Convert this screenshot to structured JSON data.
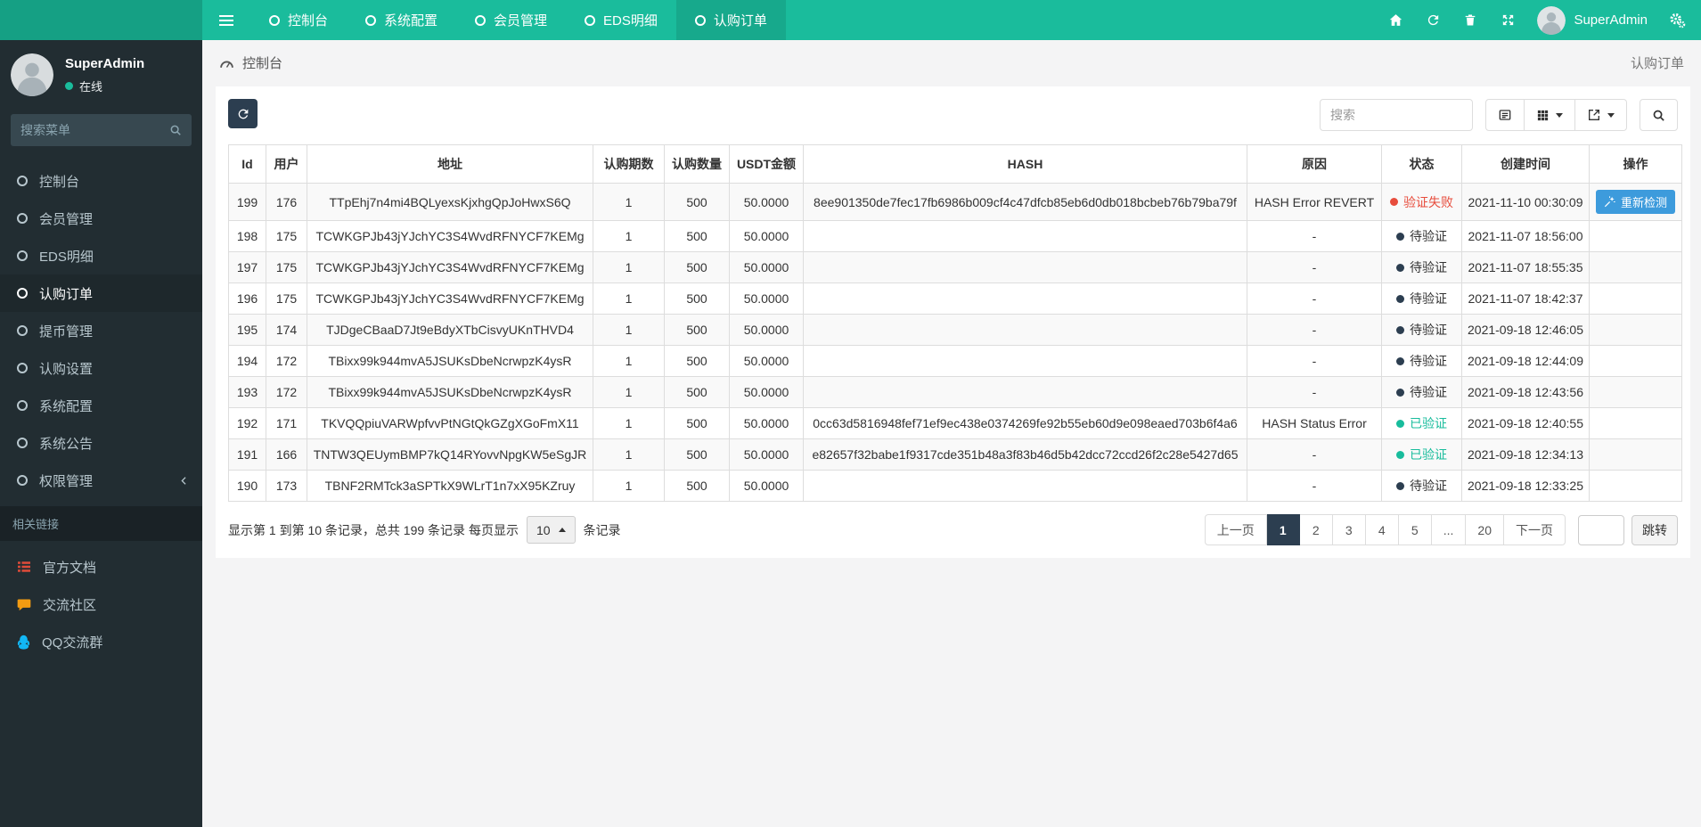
{
  "colors": {
    "navbar": "#1abc9c",
    "sidebar": "#222d32",
    "status_fail": "#e74c3c",
    "status_pending": "#2c3e50",
    "status_ok": "#18bc9c",
    "recheck_button": "#3d9bdc",
    "pagination_active": "#2c3e50"
  },
  "navbar": {
    "menu": [
      {
        "label": "控制台",
        "active": false
      },
      {
        "label": "系统配置",
        "active": false
      },
      {
        "label": "会员管理",
        "active": false
      },
      {
        "label": "EDS明细",
        "active": false
      },
      {
        "label": "认购订单",
        "active": true
      }
    ],
    "user_name": "SuperAdmin"
  },
  "sidebar": {
    "user": {
      "name": "SuperAdmin",
      "status": "在线"
    },
    "search_placeholder": "搜索菜单",
    "items": [
      {
        "label": "控制台",
        "active": false
      },
      {
        "label": "会员管理",
        "active": false
      },
      {
        "label": "EDS明细",
        "active": false
      },
      {
        "label": "认购订单",
        "active": true
      },
      {
        "label": "提币管理",
        "active": false
      },
      {
        "label": "认购设置",
        "active": false
      },
      {
        "label": "系统配置",
        "active": false
      },
      {
        "label": "系统公告",
        "active": false
      },
      {
        "label": "权限管理",
        "active": false,
        "has_submenu": true
      }
    ],
    "section_label": "相关链接",
    "links": [
      {
        "label": "官方文档",
        "icon": "doc-list-icon",
        "color": "#dd4b39"
      },
      {
        "label": "交流社区",
        "icon": "comment-icon",
        "color": "#f39c12"
      },
      {
        "label": "QQ交流群",
        "icon": "qq-icon",
        "color": "#12b7f5"
      }
    ]
  },
  "breadcrumb": {
    "left": "控制台",
    "right": "认购订单"
  },
  "toolbar": {
    "search_placeholder": "搜索"
  },
  "table": {
    "columns": [
      "Id",
      "用户",
      "地址",
      "认购期数",
      "认购数量",
      "USDT金额",
      "HASH",
      "原因",
      "状态",
      "创建时间",
      "操作"
    ],
    "rows": [
      {
        "id": "199",
        "user": "176",
        "address": "TTpEhj7n4mi4BQLyexsKjxhgQpJoHwxS6Q",
        "period": "1",
        "quantity": "500",
        "usdt": "50.0000",
        "hash": "8ee901350de7fec17fb6986b009cf4c47dfcb85eb6d0db018bcbeb76b79ba79f",
        "reason": "HASH Error REVERT",
        "status": {
          "label": "验证失败",
          "type": "fail"
        },
        "created": "2021-11-10 00:30:09",
        "action": "重新检测"
      },
      {
        "id": "198",
        "user": "175",
        "address": "TCWKGPJb43jYJchYC3S4WvdRFNYCF7KEMg",
        "period": "1",
        "quantity": "500",
        "usdt": "50.0000",
        "hash": "",
        "reason": "-",
        "status": {
          "label": "待验证",
          "type": "pending"
        },
        "created": "2021-11-07 18:56:00",
        "action": null
      },
      {
        "id": "197",
        "user": "175",
        "address": "TCWKGPJb43jYJchYC3S4WvdRFNYCF7KEMg",
        "period": "1",
        "quantity": "500",
        "usdt": "50.0000",
        "hash": "",
        "reason": "-",
        "status": {
          "label": "待验证",
          "type": "pending"
        },
        "created": "2021-11-07 18:55:35",
        "action": null
      },
      {
        "id": "196",
        "user": "175",
        "address": "TCWKGPJb43jYJchYC3S4WvdRFNYCF7KEMg",
        "period": "1",
        "quantity": "500",
        "usdt": "50.0000",
        "hash": "",
        "reason": "-",
        "status": {
          "label": "待验证",
          "type": "pending"
        },
        "created": "2021-11-07 18:42:37",
        "action": null
      },
      {
        "id": "195",
        "user": "174",
        "address": "TJDgeCBaaD7Jt9eBdyXTbCisvyUKnTHVD4",
        "period": "1",
        "quantity": "500",
        "usdt": "50.0000",
        "hash": "",
        "reason": "-",
        "status": {
          "label": "待验证",
          "type": "pending"
        },
        "created": "2021-09-18 12:46:05",
        "action": null
      },
      {
        "id": "194",
        "user": "172",
        "address": "TBixx99k944mvA5JSUKsDbeNcrwpzK4ysR",
        "period": "1",
        "quantity": "500",
        "usdt": "50.0000",
        "hash": "",
        "reason": "-",
        "status": {
          "label": "待验证",
          "type": "pending"
        },
        "created": "2021-09-18 12:44:09",
        "action": null
      },
      {
        "id": "193",
        "user": "172",
        "address": "TBixx99k944mvA5JSUKsDbeNcrwpzK4ysR",
        "period": "1",
        "quantity": "500",
        "usdt": "50.0000",
        "hash": "",
        "reason": "-",
        "status": {
          "label": "待验证",
          "type": "pending"
        },
        "created": "2021-09-18 12:43:56",
        "action": null
      },
      {
        "id": "192",
        "user": "171",
        "address": "TKVQQpiuVARWpfvvPtNGtQkGZgXGoFmX11",
        "period": "1",
        "quantity": "500",
        "usdt": "50.0000",
        "hash": "0cc63d5816948fef71ef9ec438e0374269fe92b55eb60d9e098eaed703b6f4a6",
        "reason": "HASH Status Error",
        "status": {
          "label": "已验证",
          "type": "ok"
        },
        "created": "2021-09-18 12:40:55",
        "action": null
      },
      {
        "id": "191",
        "user": "166",
        "address": "TNTW3QEUymBMP7kQ14RYovvNpgKW5eSgJR",
        "period": "1",
        "quantity": "500",
        "usdt": "50.0000",
        "hash": "e82657f32babe1f9317cde351b48a3f83b46d5b42dcc72ccd26f2c28e5427d65",
        "reason": "-",
        "status": {
          "label": "已验证",
          "type": "ok"
        },
        "created": "2021-09-18 12:34:13",
        "action": null
      },
      {
        "id": "190",
        "user": "173",
        "address": "TBNF2RMTck3aSPTkX9WLrT1n7xX95KZruy",
        "period": "1",
        "quantity": "500",
        "usdt": "50.0000",
        "hash": "",
        "reason": "-",
        "status": {
          "label": "待验证",
          "type": "pending"
        },
        "created": "2021-09-18 12:33:25",
        "action": null
      }
    ]
  },
  "pagination": {
    "info_prefix": "显示第 1 到第 10 条记录，总共 199 条记录 每页显示",
    "page_size": "10",
    "info_suffix": "条记录",
    "pages": [
      {
        "label": "上一页",
        "active": false
      },
      {
        "label": "1",
        "active": true
      },
      {
        "label": "2",
        "active": false
      },
      {
        "label": "3",
        "active": false
      },
      {
        "label": "4",
        "active": false
      },
      {
        "label": "5",
        "active": false
      },
      {
        "label": "...",
        "active": false
      },
      {
        "label": "20",
        "active": false
      },
      {
        "label": "下一页",
        "active": false
      }
    ],
    "jump_label": "跳转"
  }
}
